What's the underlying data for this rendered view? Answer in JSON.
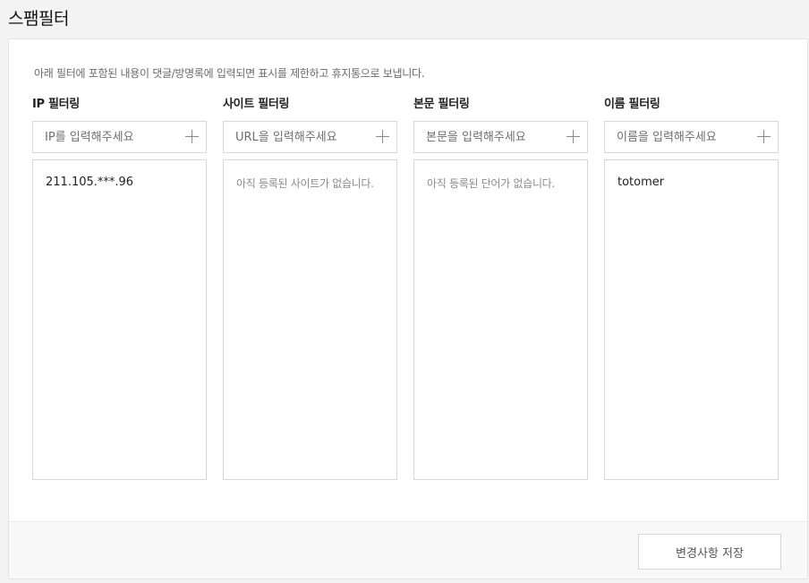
{
  "page": {
    "title": "스팸필터",
    "description": "아래 필터에 포함된 내용이 댓글/방명록에 입력되면 표시를 제한하고 휴지통으로 보냅니다."
  },
  "filters": [
    {
      "title": "IP 필터링",
      "placeholder": "IP를 입력해주세요",
      "items": [
        "211.105.***.96"
      ],
      "empty_message": ""
    },
    {
      "title": "사이트 필터링",
      "placeholder": "URL을 입력해주세요",
      "items": [],
      "empty_message": "아직 등록된 사이트가 없습니다."
    },
    {
      "title": "본문 필터링",
      "placeholder": "본문을 입력해주세요",
      "items": [],
      "empty_message": "아직 등록된 단어가 없습니다."
    },
    {
      "title": "이름 필터링",
      "placeholder": "이름을 입력해주세요",
      "items": [
        "totomer"
      ],
      "empty_message": ""
    }
  ],
  "footer": {
    "save_label": "변경사항 저장"
  }
}
